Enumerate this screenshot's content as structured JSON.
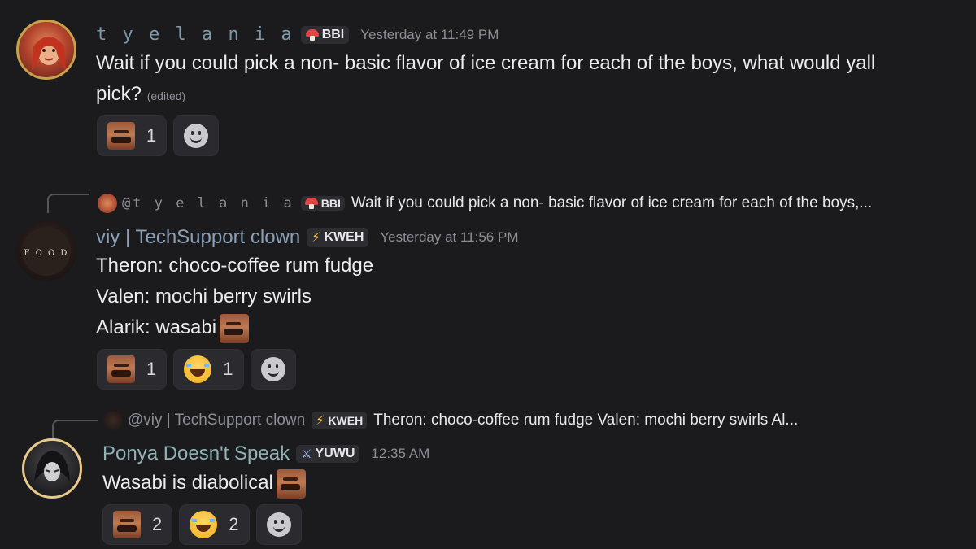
{
  "messages": [
    {
      "author": "t y e l a n i a",
      "author_color": "#7a9aa8",
      "tag": "BBI",
      "tag_icon": "mushroom-icon",
      "time": "Yesterday at 11:49 PM",
      "lines": [
        "Wait if you could pick a non- basic flavor of ice cream for each of the boys, what would yall",
        "pick?"
      ],
      "edited": "(edited)",
      "reactions": [
        {
          "emoji": "mustache-man-emoji",
          "count": "1"
        }
      ]
    },
    {
      "reply": {
        "author": "@t y e l a n i a",
        "tag": "BBI",
        "text": "Wait if you could pick a non- basic flavor of ice cream for each of the boys,..."
      },
      "author": "viy | TechSupport clown",
      "author_color": "#8a9fb4",
      "tag": "KWEH",
      "tag_icon": "lightning-icon",
      "avatar_text": "F O O D",
      "time": "Yesterday at 11:56 PM",
      "lines": [
        "Theron: choco-coffee rum fudge",
        "Valen: mochi berry swirls",
        "Alarik: wasabi"
      ],
      "reactions": [
        {
          "emoji": "mustache-man-emoji",
          "count": "1"
        },
        {
          "emoji": "laughing-crying-emoji",
          "count": "1"
        }
      ]
    },
    {
      "reply": {
        "author": "@viy | TechSupport clown",
        "tag": "KWEH",
        "text": "Theron: choco-coffee rum fudge Valen: mochi berry swirls Al..."
      },
      "author": "Ponya Doesn't Speak",
      "author_color": "#8fb3b5",
      "tag": "YUWU",
      "tag_icon": "sword-icon",
      "time": "12:35 AM",
      "lines": [
        "Wasabi is diabolical"
      ],
      "reactions": [
        {
          "emoji": "mustache-man-emoji",
          "count": "2"
        },
        {
          "emoji": "laughing-crying-emoji",
          "count": "2"
        }
      ]
    }
  ]
}
